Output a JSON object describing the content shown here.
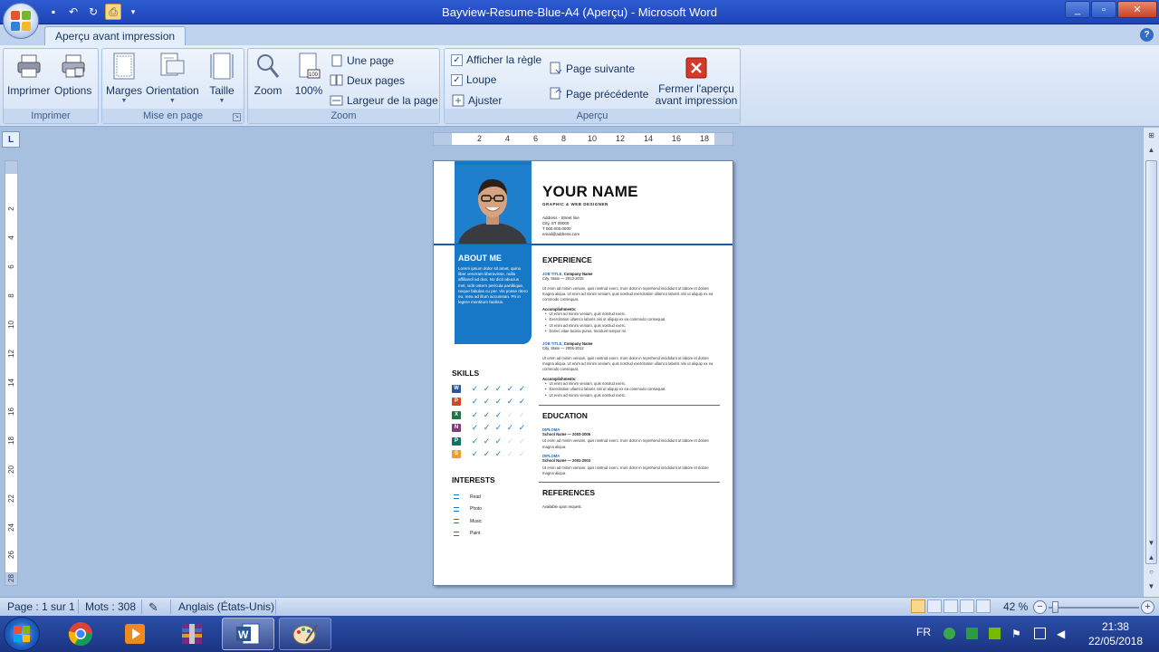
{
  "window": {
    "title": "Bayview-Resume-Blue-A4 (Aperçu) - Microsoft Word",
    "controls": [
      "_",
      "▫",
      "✕"
    ]
  },
  "tabs": [
    {
      "label": "Aperçu avant impression",
      "active": true
    }
  ],
  "ribbon": {
    "imprimer_group": {
      "label": "Imprimer",
      "print_label": "Imprimer",
      "options_label": "Options"
    },
    "mise_en_page_group": {
      "label": "Mise en page",
      "marges_label": "Marges",
      "orientation_label": "Orientation",
      "taille_label": "Taille"
    },
    "zoom_group": {
      "label": "Zoom",
      "zoom_label": "Zoom",
      "hundred_label": "100%",
      "one_page": "Une page",
      "two_pages": "Deux pages",
      "page_width": "Largeur de la page"
    },
    "apercu_group": {
      "label": "Aperçu",
      "show_ruler": "Afficher la règle",
      "show_ruler_checked": true,
      "magnifier": "Loupe",
      "magnifier_checked": true,
      "fit": "Ajuster",
      "next_page": "Page suivante",
      "prev_page": "Page précédente",
      "close_label_1": "Fermer l'aperçu",
      "close_label_2": "avant impression"
    }
  },
  "ruler": {
    "h_ticks": [
      "2",
      "4",
      "6",
      "8",
      "10",
      "12",
      "14",
      "16",
      "18"
    ],
    "v_ticks": [
      "2",
      "4",
      "6",
      "8",
      "10",
      "12",
      "14",
      "16",
      "18",
      "20",
      "22",
      "24",
      "26",
      "28"
    ]
  },
  "document": {
    "name": "YOUR NAME",
    "subtitle": "GRAPHIC & WEB DESIGNER",
    "contact": [
      "Address - Street line",
      "City, ST 00000",
      "T 000.000.0000",
      "email@address.com"
    ],
    "about_title": "ABOUT ME",
    "about_text": "Lorem ipsum dolor sit amet, quino liber veneram liberavisse, nulla affiliandi ad duo. No dicit abucius mel, vidit ostern pericula partibique, neque fabulas cu per. Vis posse ritero eu, mea ad illum accumsan. Pri in legere mentitum facilisis.",
    "skills_title": "SKILLS",
    "skills": [
      {
        "app": "W",
        "color": "#2b579a",
        "level": 5
      },
      {
        "app": "P",
        "color": "#d24726",
        "level": 5
      },
      {
        "app": "X",
        "color": "#217346",
        "level": 3
      },
      {
        "app": "N",
        "color": "#80397b",
        "level": 5
      },
      {
        "app": "P",
        "color": "#077568",
        "level": 3
      },
      {
        "app": "S",
        "color": "#e8a02a",
        "level": 3
      }
    ],
    "interests_title": "INTERESTS",
    "interests": [
      "Read",
      "Photo",
      "Music",
      "Paint"
    ],
    "experience_title": "EXPERIENCE",
    "jobs": [
      {
        "title": "JOB TITLE,",
        "company": "Company Name",
        "dates": "City, State — 2013-2015",
        "para": "Ut enim ad minim veniam, quis nostrud exerc. Irure dolor in reprehend incididunt ut labore et dolore magna aliqua. Ut enim ad minim veniam, quis nostrud exercitation ullamco laboris nisi ut aliquip ex ea commodo consequat.",
        "acc_label": "Accomplishments:",
        "bullets": [
          "Ut enim ad minim veniam, quis nostrud exerc.",
          "Exercitation ullamco laboris nisi ut aliquip ex ea commodo consequat.",
          "Ut enim ad minim veniam, quis nostrud exerc.",
          "Donec vitae lacinia purus, tincidunt tempor mi."
        ]
      },
      {
        "title": "JOB TITLE,",
        "company": "Company Name",
        "dates": "City, State — 2005-2012",
        "para": "Ut enim ad minim veniam, quis nostrud exerc. Irure dolor in reprehend incididunt ut labore et dolore magna aliqua. Ut enim ad minim veniam, quis nostrud exercitation ullamco laboris nisi ut aliquip ex ea commodo consequat.",
        "acc_label": "Accomplishments:",
        "bullets": [
          "Ut enim ad minim veniam, quis nostrud exerc.",
          "Exercitation ullamco laboris nisi ut aliquip ex ea commodo consequat.",
          "Ut enim ad minim veniam, quis nostrud exerc."
        ]
      }
    ],
    "education_title": "EDUCATION",
    "education": [
      {
        "degree": "DIPLOMA",
        "school": "School Name — 2003-2005",
        "para": "Ut enim ad minim veniam, quis nostrud exerc. Irure dolor in reprehend incididunt ut labore et dolore magna aliqua."
      },
      {
        "degree": "DIPLOMA",
        "school": "School Name — 2001-2003",
        "para": "Ut enim ad minim veniam, quis nostrud exerc. Irure dolor in reprehend incididunt ut labore et dolore magna aliqua."
      }
    ],
    "references_title": "REFERENCES",
    "references_text": "Available upon request."
  },
  "status": {
    "page": "Page : 1 sur 1",
    "words": "Mots : 308",
    "language": "Anglais (États-Unis)",
    "zoom": "42 %",
    "zoom_level_percent": 42
  },
  "taskbar": {
    "lang": "FR",
    "time": "21:38",
    "date": "22/05/2018"
  }
}
